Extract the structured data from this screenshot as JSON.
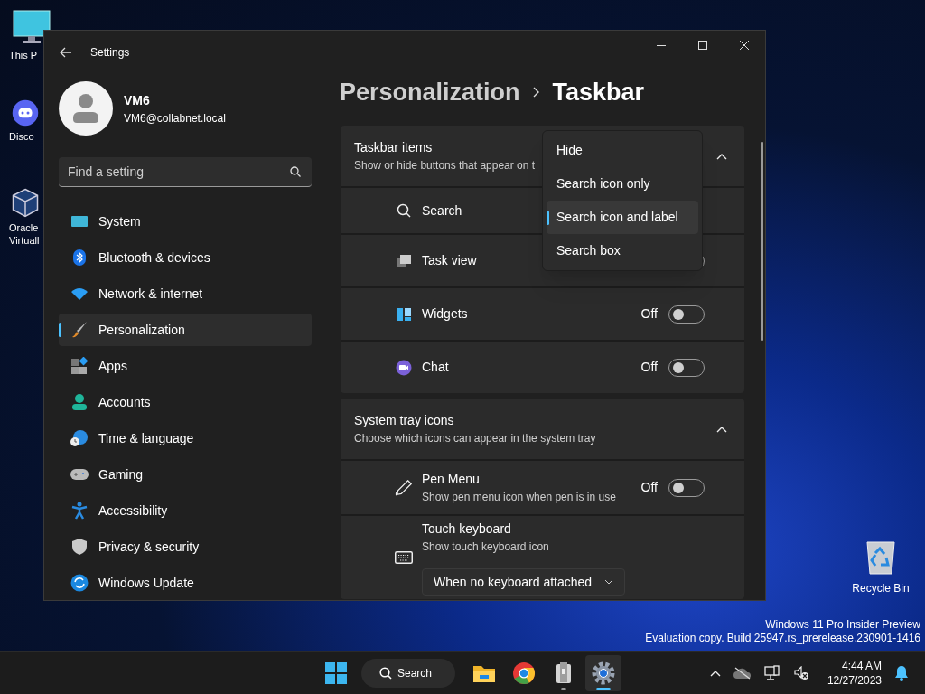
{
  "desktop_icons": [
    {
      "kind": "pc",
      "label": "This P"
    },
    {
      "kind": "chat",
      "label": "Disco"
    },
    {
      "kind": "cube",
      "label": "Oracle Virtuall"
    }
  ],
  "recycle_bin": {
    "label": "Recycle Bin"
  },
  "window": {
    "title": "Settings"
  },
  "user": {
    "name": "VM6",
    "email": "VM6@collabnet.local"
  },
  "search": {
    "placeholder": "Find a setting"
  },
  "nav": [
    {
      "label": "System",
      "selected": false
    },
    {
      "label": "Bluetooth & devices",
      "selected": false
    },
    {
      "label": "Network & internet",
      "selected": false
    },
    {
      "label": "Personalization",
      "selected": true
    },
    {
      "label": "Apps",
      "selected": false
    },
    {
      "label": "Accounts",
      "selected": false
    },
    {
      "label": "Time & language",
      "selected": false
    },
    {
      "label": "Gaming",
      "selected": false
    },
    {
      "label": "Accessibility",
      "selected": false
    },
    {
      "label": "Privacy & security",
      "selected": false
    },
    {
      "label": "Windows Update",
      "selected": false
    }
  ],
  "breadcrumb": [
    "Personalization",
    "Taskbar"
  ],
  "sections": [
    {
      "title": "Taskbar items",
      "subtitle": "Show or hide buttons that appear on t",
      "expanded": true,
      "rows": [
        {
          "kind": "plain",
          "label": "Search"
        },
        {
          "kind": "toggle",
          "label": "Task view",
          "on": false
        },
        {
          "kind": "toggle",
          "label": "Widgets",
          "on": false,
          "state_text": "Off"
        },
        {
          "kind": "toggle",
          "label": "Chat",
          "on": false,
          "state_text": "Off"
        }
      ]
    },
    {
      "title": "System tray icons",
      "subtitle": "Choose which icons can appear in the system tray",
      "expanded": true,
      "rows": [
        {
          "kind": "toggle",
          "label": "Pen Menu",
          "subtitle": "Show pen menu icon when pen is in use",
          "on": false,
          "state_text": "Off"
        },
        {
          "kind": "select",
          "label": "Touch keyboard",
          "subtitle": "Show touch keyboard icon",
          "value": "When no keyboard attached"
        }
      ]
    }
  ],
  "dropdown_menu": [
    {
      "label": "Hide",
      "selected": false
    },
    {
      "label": "Search icon only",
      "selected": false
    },
    {
      "label": "Search icon and label",
      "selected": true
    },
    {
      "label": "Search box",
      "selected": false
    }
  ],
  "watermark": [
    "Windows 11 Pro Insider Preview",
    "Evaluation copy. Build 25947.rs_prerelease.230901-1416"
  ],
  "taskbar": {
    "search": "Search",
    "apps": [
      {
        "kind": "folder",
        "running": false,
        "active": false
      },
      {
        "kind": "browser",
        "running": false,
        "active": false
      },
      {
        "kind": "archive",
        "running": true,
        "active": false
      },
      {
        "kind": "gear",
        "running": true,
        "active": true
      }
    ],
    "time": "4:44 AM",
    "date": "12/27/2023"
  }
}
